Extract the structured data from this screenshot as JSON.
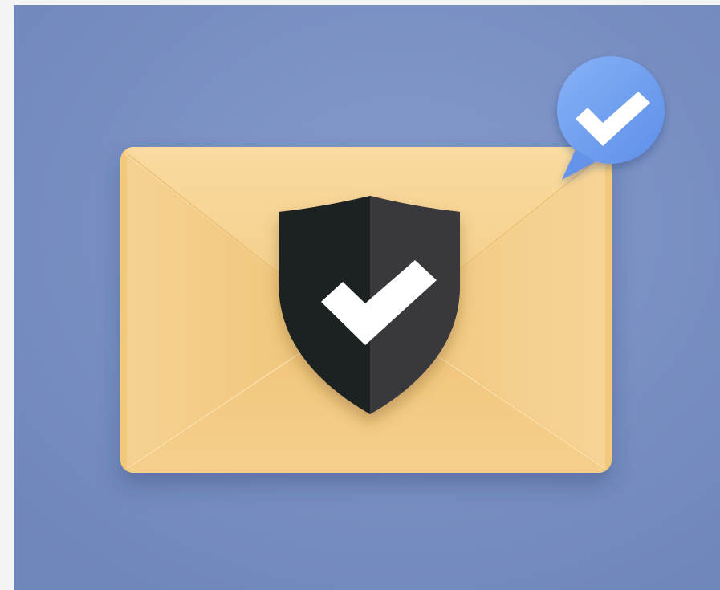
{
  "image": {
    "subject": "secure-email-illustration",
    "colors": {
      "background": "#6f86bb",
      "background_light": "#859bcc",
      "envelope": "#f3c97e",
      "envelope_light": "#f8d89a",
      "envelope_dark": "#e3b46a",
      "shield_dark": "#202124",
      "shield_light": "#36373b",
      "badge": "#6f9df2",
      "check": "#ffffff"
    },
    "icons": [
      "envelope-icon",
      "shield-icon",
      "checkmark-icon",
      "chat-bubble-icon"
    ]
  }
}
